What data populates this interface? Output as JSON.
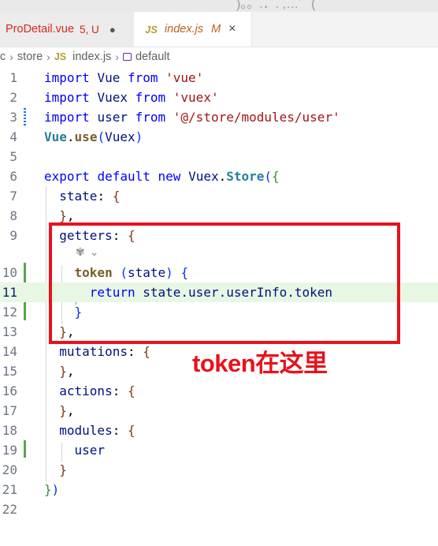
{
  "tabs": [
    {
      "name": "ProDetail.vue",
      "status": "5, U",
      "dirty_marker": "●"
    },
    {
      "badge": "JS",
      "name": "index.js",
      "status": "M",
      "close": "×"
    }
  ],
  "breadcrumb": {
    "items": [
      "c",
      "store",
      "index.js",
      "default"
    ],
    "file_badge": "JS",
    "symbol_icon": "cube-icon"
  },
  "annotation": "token在这里",
  "code_lens_icons": [
    "copilot-icon",
    "chevron-down-icon"
  ],
  "lines": [
    {
      "n": "1"
    },
    {
      "n": "2"
    },
    {
      "n": "3"
    },
    {
      "n": "4"
    },
    {
      "n": "5"
    },
    {
      "n": "6"
    },
    {
      "n": "7"
    },
    {
      "n": "8"
    },
    {
      "n": "9"
    },
    {
      "n": "10"
    },
    {
      "n": "11"
    },
    {
      "n": "12"
    },
    {
      "n": "13"
    },
    {
      "n": "14"
    },
    {
      "n": "15"
    },
    {
      "n": "16"
    },
    {
      "n": "17"
    },
    {
      "n": "18"
    },
    {
      "n": "19"
    },
    {
      "n": "20"
    },
    {
      "n": "21"
    },
    {
      "n": "22"
    }
  ],
  "code": {
    "import": "import",
    "from": "from",
    "vue_id": "Vue",
    "vue_str": "'vue'",
    "vuex_id": "Vuex",
    "vuex_str": "'vuex'",
    "user_id": "user",
    "user_str": "'@/store/modules/user'",
    "vue_use": "Vue",
    "use": "use",
    "vuex_arg": "Vuex",
    "export": "export",
    "default": "default",
    "new": "new",
    "vuex_cls": "Vuex",
    "store": "Store",
    "state_key": "state",
    "getters_key": "getters",
    "token_fn": "token",
    "state_param": "state",
    "return": "return",
    "return_expr": "state.user.userInfo.token",
    "mutations_key": "mutations",
    "actions_key": "actions",
    "modules_key": "modules",
    "user_entry": "user"
  }
}
